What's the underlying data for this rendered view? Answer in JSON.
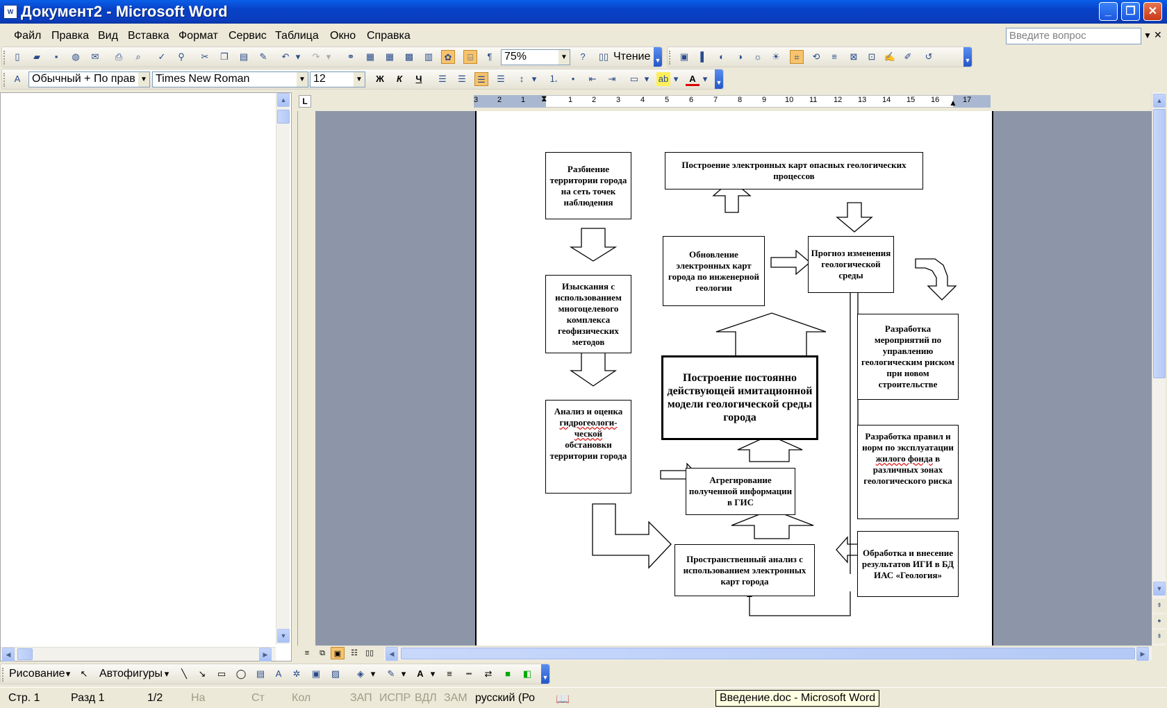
{
  "window": {
    "title": "Документ2 - Microsoft Word",
    "icon_label": "W"
  },
  "menu": {
    "items": [
      "Файл",
      "Правка",
      "Вид",
      "Вставка",
      "Формат",
      "Сервис",
      "Таблица",
      "Окно",
      "Справка"
    ],
    "help_placeholder": "Введите вопрос"
  },
  "standard_toolbar": {
    "zoom": "75%",
    "reading_label": "Чтение"
  },
  "format_toolbar": {
    "style": "Обычный + По прав",
    "font": "Times New Roman",
    "size": "12",
    "bold": "Ж",
    "italic": "К",
    "underline": "Ч"
  },
  "ruler": {
    "marks": [
      "3",
      "2",
      "1",
      "1",
      "2",
      "3",
      "4",
      "5",
      "6",
      "7",
      "8",
      "9",
      "10",
      "11",
      "12",
      "13",
      "14",
      "15",
      "16",
      "17"
    ]
  },
  "diagram": {
    "box1": "Разбиение территории города на сеть точек наблюдения",
    "box2": "Построение электронных карт опасных геологических процессов",
    "box3": "Обновление электронных карт города по инженерной геологии",
    "box4": "Прогноз изменения геологической среды",
    "box5": "Изыскания с использованием многоцелевого комплекса геофизических методов",
    "box6": "Разработка мероприятий по управлению геологическим риском при новом строительстве",
    "box7": "Построение постоянно действующей имитационной модели геологической среды города",
    "box8_a": "Анализ и оценка",
    "box8_b": "гидрогеологи-",
    "box8_c": "ческой",
    "box8_d": "обстановки территории города",
    "box9": "Агрегирование полученной информации в ГИС",
    "box10_a": "Разработка правил и норм по эксплуатации",
    "box10_b": "жилого фонда",
    "box10_c": "в различных зонах геологического риска",
    "box11": "Пространственный анализ с использованием электронных карт города",
    "box12": "Обработка и внесение результатов ИГИ в БД ИАС «Геология»"
  },
  "drawing_toolbar": {
    "drawing_label": "Рисование",
    "autoshapes_label": "Автофигуры"
  },
  "status": {
    "page": "Стр. 1",
    "section": "Разд 1",
    "pages": "1/2",
    "at": "На",
    "line": "Ст",
    "col": "Кол",
    "rec": "ЗАП",
    "trk": "ИСПР",
    "ext": "ВДЛ",
    "ovr": "ЗАМ",
    "lang": "русский (Ро"
  },
  "tooltip": "Введение.doc - Microsoft Word"
}
